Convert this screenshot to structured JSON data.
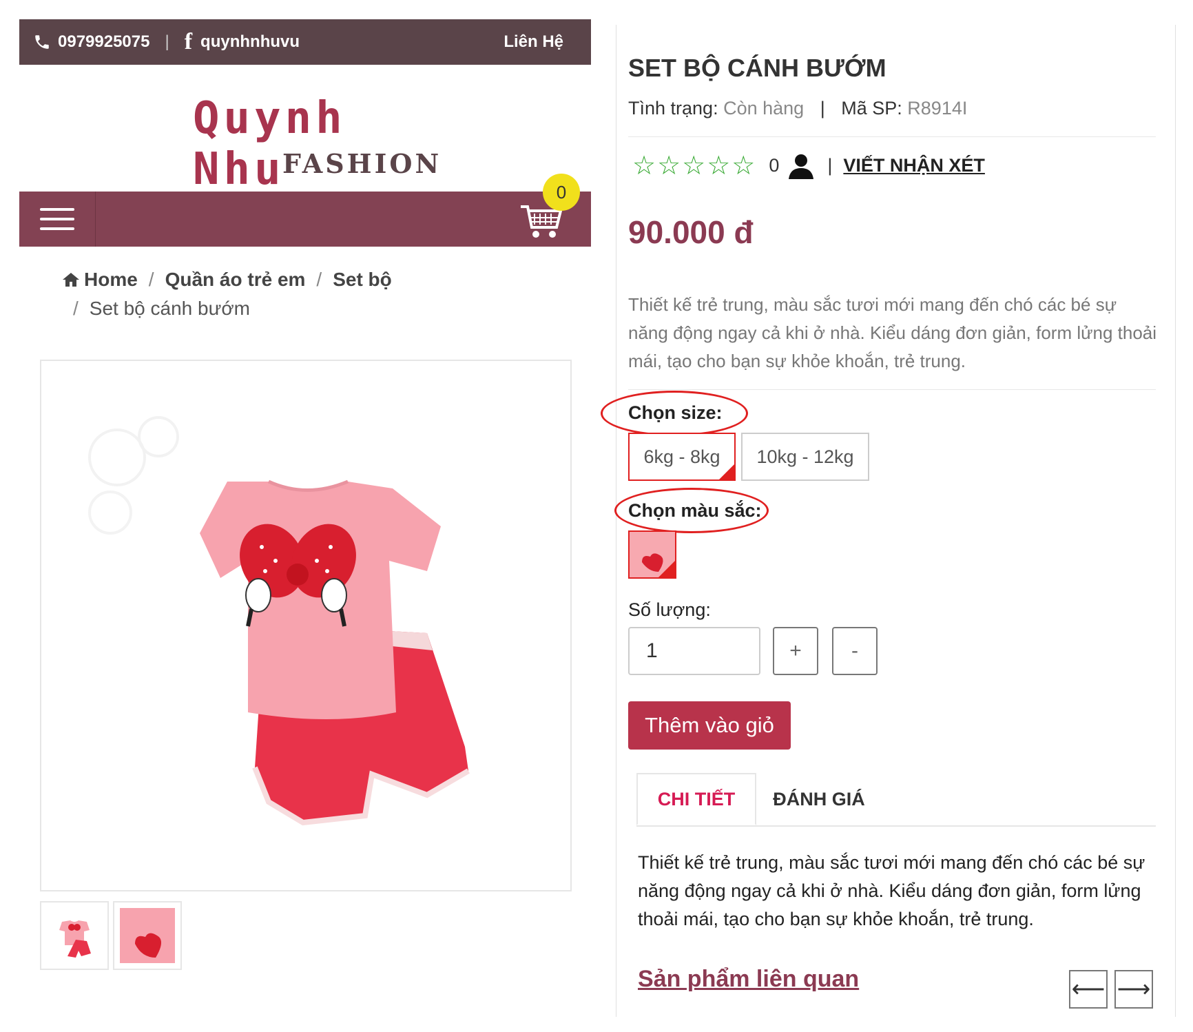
{
  "header": {
    "phone": "0979925075",
    "facebook": "quynhnhuvu",
    "contact": "Liên Hệ",
    "logo_main": "Quynh Nhu",
    "logo_sub": "FASHION",
    "cart_count": "0"
  },
  "breadcrumb": {
    "home": "Home",
    "cat1": "Quần áo trẻ em",
    "cat2": "Set bộ",
    "current": "Set bộ cánh bướm"
  },
  "product": {
    "title": "SET BỘ CÁNH BƯỚM",
    "status_label": "Tình trạng:",
    "status_value": "Còn hàng",
    "sku_label": "Mã SP:",
    "sku_value": "R8914I",
    "stars": "☆☆☆☆☆",
    "review_count": "0",
    "review_link": "VIẾT NHẬN XÉT",
    "price": "90.000 đ",
    "description": "Thiết kế trẻ trung, màu sắc tươi mới mang đến chó các bé sự năng động ngay cả khi ở nhà. Kiểu dáng đơn giản, form lửng thoải mái, tạo cho bạn sự khỏe khoắn, trẻ trung."
  },
  "options": {
    "size_label": "Chọn size:",
    "sizes": [
      "6kg - 8kg",
      "10kg - 12kg"
    ],
    "color_label": "Chọn màu sắc:",
    "qty_label": "Số lượng:",
    "qty_value": "1",
    "plus": "+",
    "minus": "-",
    "add_to_cart": "Thêm vào giỏ"
  },
  "tabs": {
    "detail": "CHI TIẾT",
    "review": "ĐÁNH GIÁ",
    "detail_text": "Thiết kế trẻ trung, màu sắc tươi mới mang đến chó các bé sự năng động ngay cả khi ở nhà. Kiểu dáng đơn giản, form lửng thoải mái, tạo cho bạn sự khỏe khoắn, trẻ trung."
  },
  "related": {
    "title": "Sản phẩm liên quan",
    "prev": "⟵",
    "next": "⟶"
  },
  "colors": {
    "topbar": "#5a4449",
    "navbar": "#834253",
    "accent": "#b8334b",
    "price": "#8b3a52",
    "star": "#3aaa35",
    "badge": "#f1e01c"
  }
}
